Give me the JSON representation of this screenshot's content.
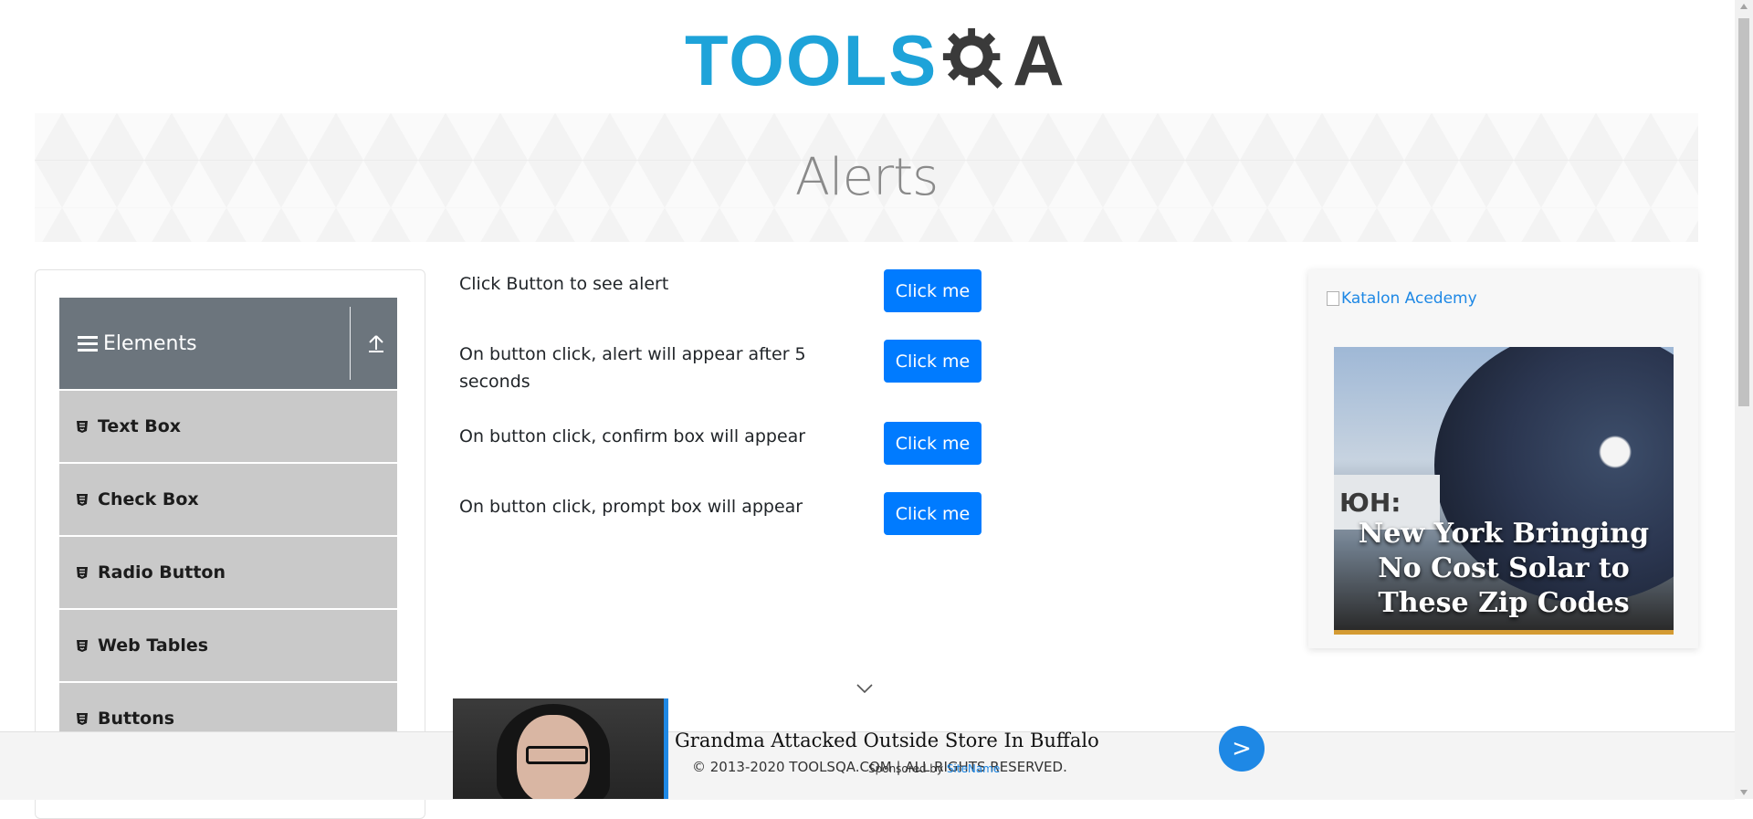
{
  "header": {
    "logo_tools": "TOOLS",
    "logo_qa": "A"
  },
  "banner": {
    "title": "Alerts"
  },
  "sidebar": {
    "group_title": "Elements",
    "items": [
      {
        "label": "Text Box"
      },
      {
        "label": "Check Box"
      },
      {
        "label": "Radio Button"
      },
      {
        "label": "Web Tables"
      },
      {
        "label": "Buttons"
      }
    ]
  },
  "alerts": [
    {
      "text": "Click Button to see alert",
      "button": "Click me"
    },
    {
      "text": "On button click, alert will appear after 5 seconds",
      "button": "Click me"
    },
    {
      "text": "On button click, confirm box will appear",
      "button": "Click me"
    },
    {
      "text": "On button click, prompt box will appear",
      "button": "Click me"
    }
  ],
  "ad_panel": {
    "link_text": "Katalon Acedemy",
    "sign_text": "ЮН:",
    "headline": "New York Bringing No Cost Solar to These Zip Codes"
  },
  "footer": {
    "copyright": "© 2013-2020 TOOLSQA.COM | ALL RIGHTS RESERVED."
  },
  "bottom_ad": {
    "headline": "Grandma Attacked Outside Store In Buffalo",
    "sponsored_prefix": "Sponsored by",
    "sponsor": "SiteName",
    "go_label": ">"
  },
  "colors": {
    "primary_button": "#007bff",
    "sidebar_header": "#6c757d",
    "sidebar_item": "#c9c9c9",
    "logo_blue": "#1ea3d9",
    "logo_dark": "#3a3a3a"
  }
}
